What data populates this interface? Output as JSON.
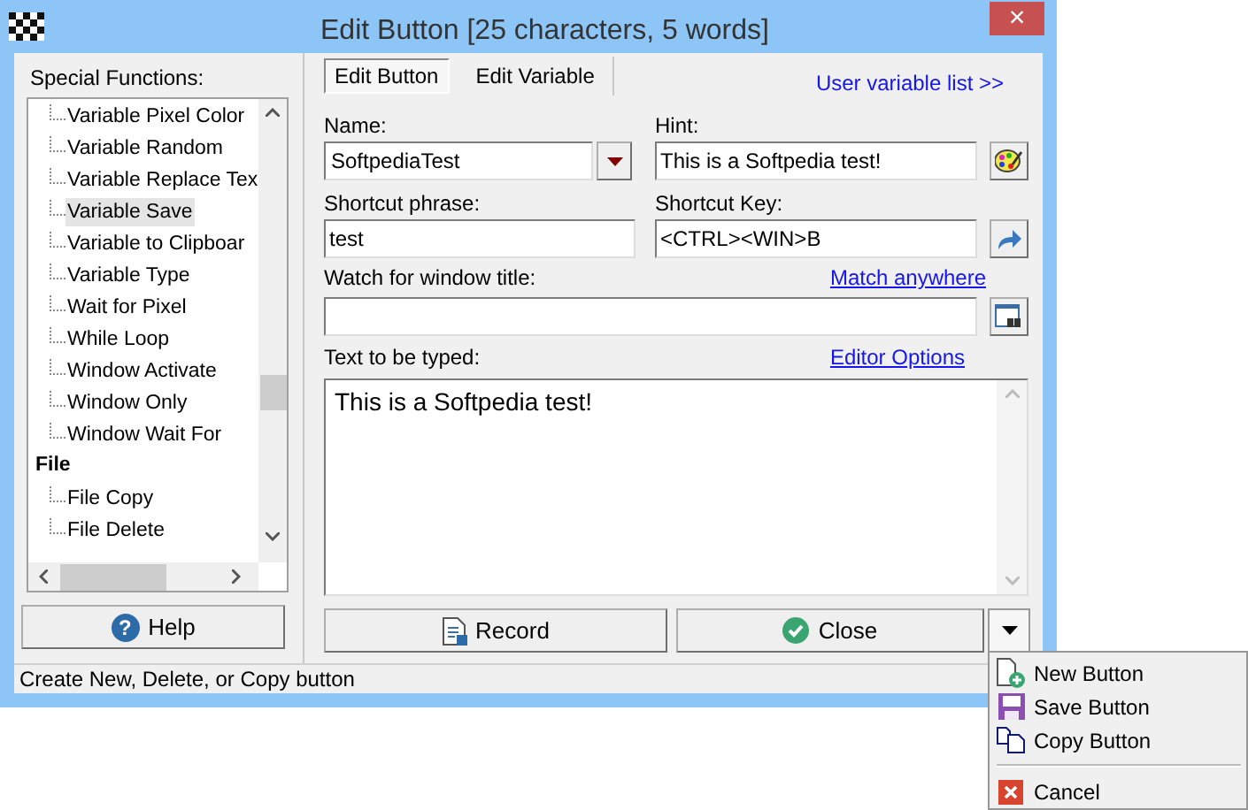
{
  "window": {
    "title": "Edit Button [25 characters, 5 words]",
    "close": "×"
  },
  "special_functions": {
    "label": "Special Functions:",
    "tree": [
      {
        "kind": "continued",
        "children": [
          {
            "label": "Variable Pixel Color",
            "selected": false
          },
          {
            "label": "Variable Random",
            "selected": false
          },
          {
            "label": "Variable Replace Tex",
            "selected": false
          },
          {
            "label": "Variable Save",
            "selected": true
          },
          {
            "label": "Variable to Clipboar",
            "selected": false
          },
          {
            "label": "Variable Type",
            "selected": false
          },
          {
            "label": "Wait for Pixel",
            "selected": false
          },
          {
            "label": "While Loop",
            "selected": false
          },
          {
            "label": "Window Activate",
            "selected": false
          },
          {
            "label": "Window Only",
            "selected": false
          },
          {
            "label": "Window Wait For",
            "selected": false
          }
        ]
      },
      {
        "kind": "group",
        "label": "File",
        "selected": false,
        "children": [
          {
            "label": "File Copy",
            "selected": false
          },
          {
            "label": "File Delete",
            "selected": false
          }
        ]
      }
    ]
  },
  "help_button": {
    "icon": "?",
    "label": "Help"
  },
  "tabs": [
    {
      "label": "Edit Button",
      "selected": true
    },
    {
      "label": "Edit Variable",
      "selected": false
    }
  ],
  "user_variable_link": "User variable list >>",
  "name": {
    "label": "Name:",
    "value": "SoftpediaTest"
  },
  "hint": {
    "label": "Hint:",
    "value": "This is a Softpedia test!"
  },
  "shortcut_phrase": {
    "label": "Shortcut phrase:",
    "value": "test"
  },
  "shortcut_key": {
    "label": "Shortcut Key:",
    "value": "<CTRL><WIN>B"
  },
  "watch_title": {
    "label": "Watch for window title:",
    "link": "Match anywhere"
  },
  "text_to_type": {
    "label": "Text to be typed:",
    "link": "Editor Options",
    "value": "This is a Softpedia test!"
  },
  "record_button": "Record",
  "close_button": "Close",
  "menu": {
    "items": [
      {
        "kind": "new",
        "label": "New Button",
        "separator_before": false
      },
      {
        "kind": "save",
        "label": "Save Button",
        "separator_before": false
      },
      {
        "kind": "copy",
        "label": "Copy Button",
        "separator_before": false
      },
      {
        "kind": "cancel",
        "label": "Cancel",
        "separator_before": true
      }
    ]
  },
  "status_bar": "Create New, Delete, or Copy button"
}
